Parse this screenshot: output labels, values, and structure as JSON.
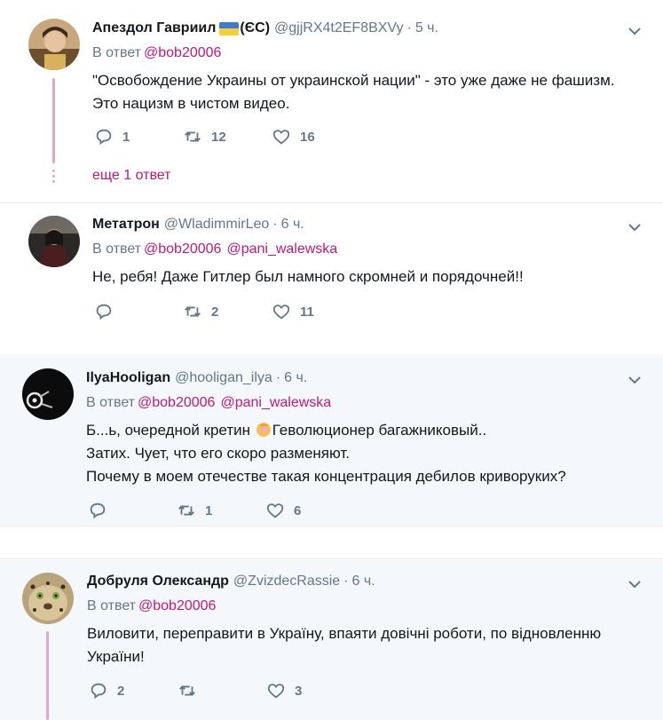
{
  "tweets": [
    {
      "name": "Апездол Гавриил",
      "name_suffix": "(ЄС)",
      "handle": "@gjjRX4t2EF8BXVy",
      "time": "5 ч.",
      "reply_prefix": "В ответ",
      "mentions": [
        "@bob20006"
      ],
      "lines": [
        "\"Освобождение Украины от украинской нации\" - это уже даже не фашизм.",
        "Это нацизм в чистом видео."
      ],
      "replies": "1",
      "retweets": "12",
      "likes": "16",
      "more_replies": "еще 1 ответ"
    },
    {
      "name": "Метатрон",
      "handle": "@WladimmirLeo",
      "time": "6 ч.",
      "reply_prefix": "В ответ",
      "mentions": [
        "@bob20006",
        "@pani_walewska"
      ],
      "lines": [
        "Не, ребя! Даже Гитлер был намного скромней и порядочней!!"
      ],
      "replies": "",
      "retweets": "2",
      "likes": "11"
    },
    {
      "name": "IlyaHooligan",
      "handle": "@hooligan_ilya",
      "time": "6 ч.",
      "reply_prefix": "В ответ",
      "mentions": [
        "@bob20006",
        "@pani_walewska"
      ],
      "line1_a": "Б...ь,  очередной кретин",
      "line1_b": "Геволюционер багажниковый..",
      "lines": [
        "Затих. Чует, что его скоро разменяют.",
        "Почему в моем отечестве такая концентрация дебилов криворуких?"
      ],
      "replies": "",
      "retweets": "1",
      "likes": "6"
    },
    {
      "name": "Добруля Олександр",
      "handle": "@ZvizdecRassie",
      "time": "6 ч.",
      "reply_prefix": "В ответ",
      "mentions": [
        "@bob20006"
      ],
      "lines": [
        "Виловити, переправити в Україну, впаяти довічні роботи, по відновленню",
        "України!"
      ],
      "replies": "2",
      "retweets": "",
      "likes": "3"
    }
  ],
  "colors": {
    "mention": "#c2187c",
    "thread": "#e0a8c8",
    "muted": "#657786",
    "alt_bg": "#f5f8fa"
  },
  "icons": [
    "reply-icon",
    "retweet-icon",
    "like-icon",
    "chevron-down-icon",
    "flag-ukraine-icon",
    "facepalm-emoji-icon"
  ]
}
